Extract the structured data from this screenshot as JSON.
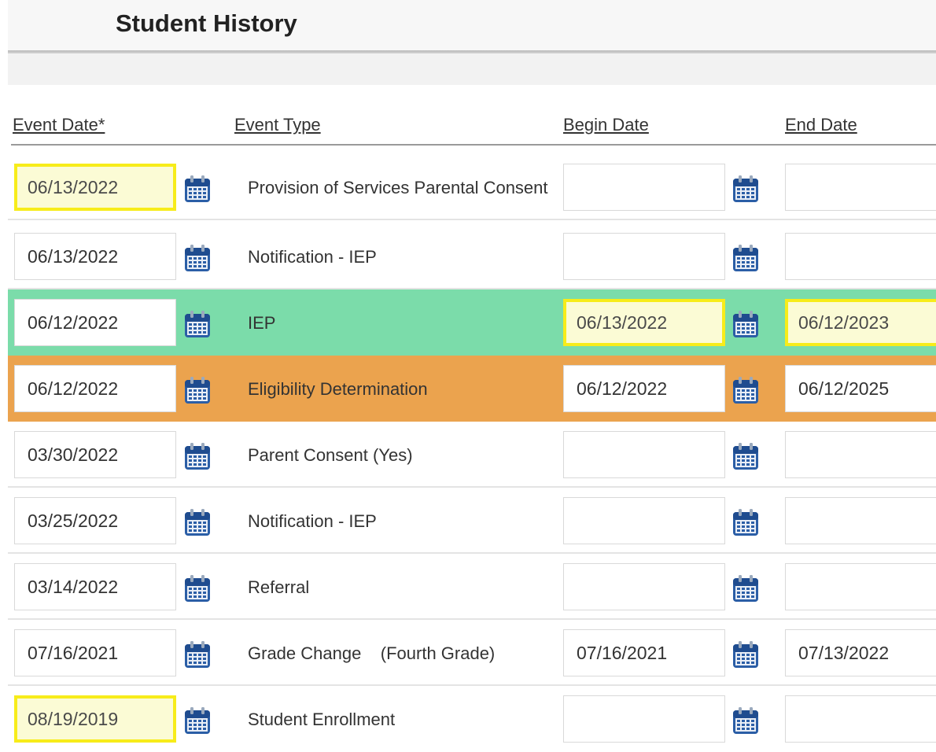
{
  "page": {
    "title": "Student History"
  },
  "columns": {
    "event_date": "Event Date*",
    "event_type": "Event Type",
    "begin_date": "Begin Date",
    "end_date": "End Date"
  },
  "colors": {
    "iep_row": "#7bdcaa",
    "eligibility_row": "#eba34e",
    "highlight_border": "#f7ec1a",
    "highlight_fill": "#fbfbd5",
    "calendar_icon": "#2b5ea6"
  },
  "rows": [
    {
      "event_date": "06/13/2022",
      "event_type": "Provision of Services Parental Consent",
      "begin_date": "",
      "end_date": ""
    },
    {
      "event_date": "06/13/2022",
      "event_type": "Notification - IEP",
      "begin_date": "",
      "end_date": ""
    },
    {
      "event_date": "06/12/2022",
      "event_type": "IEP",
      "begin_date": "06/13/2022",
      "end_date": "06/12/2023"
    },
    {
      "event_date": "06/12/2022",
      "event_type": "Eligibility Determination",
      "begin_date": "06/12/2022",
      "end_date": "06/12/2025"
    },
    {
      "event_date": "03/30/2022",
      "event_type": "Parent Consent (Yes)",
      "begin_date": "",
      "end_date": ""
    },
    {
      "event_date": "03/25/2022",
      "event_type": "Notification - IEP",
      "begin_date": "",
      "end_date": ""
    },
    {
      "event_date": "03/14/2022",
      "event_type": "Referral",
      "begin_date": "",
      "end_date": ""
    },
    {
      "event_date": "07/16/2021",
      "event_type": "Grade Change    (Fourth Grade)",
      "begin_date": "07/16/2021",
      "end_date": "07/13/2022"
    },
    {
      "event_date": "08/19/2019",
      "event_type": "Student Enrollment",
      "begin_date": "",
      "end_date": ""
    }
  ]
}
